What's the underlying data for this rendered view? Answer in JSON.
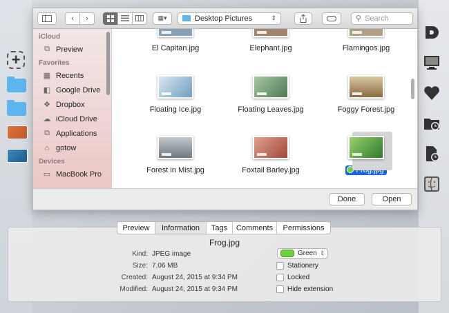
{
  "toolbar": {
    "path_label": "Desktop Pictures",
    "search_placeholder": "Search"
  },
  "sidebar": {
    "sections": [
      {
        "title": "iCloud",
        "items": [
          {
            "label": "Preview",
            "icon": "app-icon"
          }
        ]
      },
      {
        "title": "Favorites",
        "items": [
          {
            "label": "Recents",
            "icon": "recents-icon"
          },
          {
            "label": "Google Drive",
            "icon": "folder-icon"
          },
          {
            "label": "Dropbox",
            "icon": "dropbox-icon"
          },
          {
            "label": "iCloud Drive",
            "icon": "cloud-icon"
          },
          {
            "label": "Applications",
            "icon": "apps-icon"
          },
          {
            "label": "gotow",
            "icon": "home-icon"
          }
        ]
      },
      {
        "title": "Devices",
        "items": [
          {
            "label": "MacBook Pro",
            "icon": "laptop-icon"
          }
        ]
      }
    ]
  },
  "files": [
    {
      "name": "El Capitan.jpg",
      "color": "#8aa0b4"
    },
    {
      "name": "Elephant.jpg",
      "color": "#a08470"
    },
    {
      "name": "Flamingos.jpg",
      "color": "#b0a088"
    },
    {
      "name": "Floating Ice.jpg",
      "color": "#6f9ec0"
    },
    {
      "name": "Floating Leaves.jpg",
      "color": "#6b8f6a"
    },
    {
      "name": "Foggy Forest.jpg",
      "color": "#b09a70"
    },
    {
      "name": "Forest in Mist.jpg",
      "color": "#8d98a0"
    },
    {
      "name": "Foxtail Barley.jpg",
      "color": "#b46a5c"
    },
    {
      "name": "Frog.jpg",
      "color": "#4e9a3a",
      "selected": true
    }
  ],
  "footer": {
    "done_label": "Done",
    "open_label": "Open"
  },
  "info": {
    "tabs": [
      "Preview",
      "Information",
      "Tags",
      "Comments",
      "Permissions"
    ],
    "active_tab": "Information",
    "filename": "Frog.jpg",
    "kind_label": "Kind:",
    "kind": "JPEG image",
    "size_label": "Size:",
    "size": "7.06 MB",
    "created_label": "Created:",
    "created": "August 24, 2015 at 9:34 PM",
    "modified_label": "Modified:",
    "modified": "August 24, 2015 at 9:34 PM",
    "tag": "Green",
    "tag_color": "#6bd03a",
    "checkboxes": [
      "Stationery",
      "Locked",
      "Hide extension"
    ]
  },
  "colors": {
    "selection": "#1a66d9",
    "folder": "#5db5ee"
  }
}
